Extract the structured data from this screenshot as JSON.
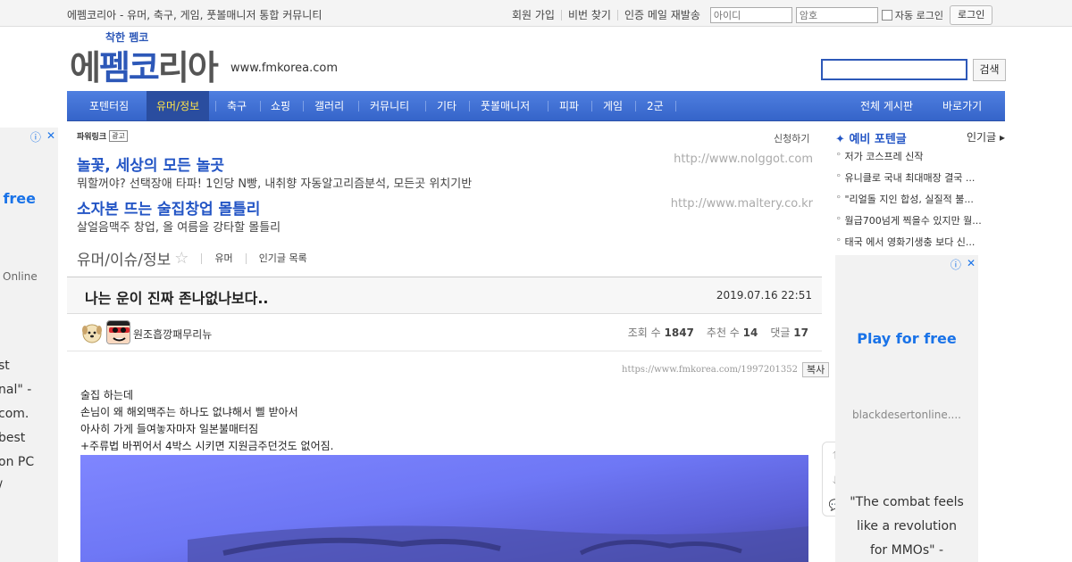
{
  "topbar": {
    "site_description": "에펨코리아 - 유머, 축구, 게임, 풋볼매니저 통합 커뮤니티",
    "links": [
      "회원 가입",
      "비번 찾기",
      "인증 메일 재발송"
    ],
    "id_placeholder": "아이디",
    "pw_placeholder": "암호",
    "auto_login": "자동 로그인",
    "login_button": "로그인"
  },
  "logo": {
    "slogan": "착한 펨코",
    "text_part1": "에",
    "text_part2": "펨코",
    "text_part3": "리아",
    "domain": "www.fmkorea.com"
  },
  "search": {
    "button": "검색"
  },
  "nav": {
    "items": [
      "포텐터짐",
      "유머/정보",
      "축구",
      "쇼핑",
      "갤러리",
      "커뮤니티",
      "기타",
      "풋볼매니저",
      "피파",
      "게임",
      "2군"
    ],
    "active_index": 1,
    "right_items": [
      "전체 게시판",
      "바로가기"
    ]
  },
  "left_ad": {
    "info_icon": "info-icon",
    "close_icon": "close-icon",
    "headline": "free",
    "source": "Online",
    "lines": [
      "st",
      "nal\" -",
      "com.",
      "best",
      "on PC",
      "/"
    ]
  },
  "powerlink": {
    "label": "파워링크",
    "ad_badge": "광고",
    "apply": "신청하기",
    "ads": [
      {
        "title": "놀꽃, 세상의 모든 놀곳",
        "desc": "뭐할꺼야? 선택장애 타파! 1인당 N빵, 내취향 자동알고리즘분석, 모든곳 위치기반",
        "url": "http://www.nolggot.com"
      },
      {
        "title": "소자본 뜨는 술집창업 몰틀리",
        "desc": "살얼음맥주 창업, 올 여름을 강타할 몰틀리",
        "url": "http://www.maltery.co.kr"
      }
    ]
  },
  "board": {
    "name": "유머/이슈/정보",
    "sub_links": [
      "유머",
      "인기글 목록"
    ]
  },
  "post": {
    "title": "나는 운이 진짜 존나없나보다..",
    "date": "2019.07.16 22:51",
    "author": "원조흡깡패무리뉴",
    "views_label": "조회 수",
    "views": "1847",
    "recommend_label": "추천 수",
    "recommend": "14",
    "comments_label": "댓글",
    "comments": "17",
    "url": "https://www.fmkorea.com/1997201352",
    "copy_button": "복사",
    "body_lines": [
      "술집 하는데",
      "손님이 왜 해외맥주는 하나도 없냐해서 삘 받아서",
      "아사히 가게 들여놓자마자 일본불매터짐",
      "+주류법 바뀌어서 4박스 시키면 지원금주던것도 없어짐."
    ]
  },
  "float_buttons": [
    "arrow-up-icon",
    "arrow-down-icon",
    "comment-icon"
  ],
  "sidebar": {
    "title": "예비 포텐글",
    "more": "인기글",
    "items": [
      "저가 코스프레 신작",
      "유니클로 국내 최대매장 결국 ...",
      "\"리얼돌 지인 합성, 실질적 불...",
      "월급700넘게 찍을수 있지만 월...",
      "태국 에서 영화기생충 보다 신..."
    ]
  },
  "right_ad": {
    "headline": "Play for free",
    "url": "blackdesertonline....",
    "quote_lines": [
      "\"The combat feels",
      "like a revolution",
      "for MMOs\" -"
    ]
  },
  "colors": {
    "brand_blue": "#2d58b8",
    "nav_blue": "#3f6fd6",
    "active_text": "#ffe34a",
    "ad_blue": "#1a73e8"
  }
}
